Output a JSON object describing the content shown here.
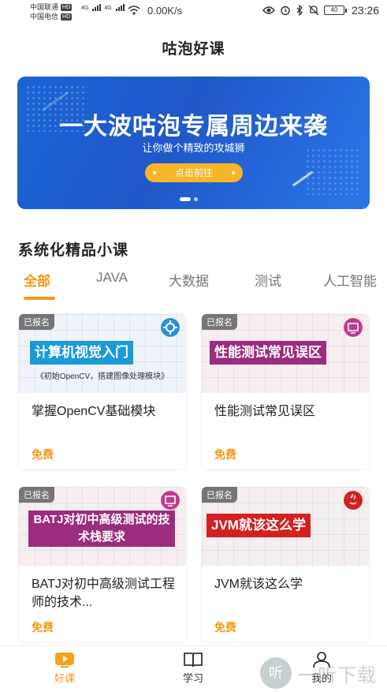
{
  "status_bar": {
    "carrier1": "中国联通",
    "carrier2": "中国电信",
    "hd": "HD",
    "net_type": "4G",
    "speed": "0.00K/s",
    "battery": "40",
    "time": "23:26"
  },
  "app": {
    "title": "咕泡好课"
  },
  "banner": {
    "headline": "一大波咕泡专属周边来袭",
    "subtitle": "让你做个精致的攻城狮",
    "button": "点击前往"
  },
  "section": {
    "title": "系统化精品小课"
  },
  "tabs": [
    "全部",
    "JAVA",
    "大数据",
    "测试",
    "人工智能"
  ],
  "courses": [
    {
      "badge": "已报名",
      "thumb_title": "计算机视觉入门",
      "thumb_sub": "《初始OpenCV，搭建图像处理模块》",
      "name": "掌握OpenCV基础模块",
      "price": "免费",
      "title_color": "#1a9bd7",
      "icon": "gear-icon"
    },
    {
      "badge": "已报名",
      "thumb_title": "性能测试常见误区",
      "thumb_sub": "",
      "name": "性能测试常见误区",
      "price": "免费",
      "title_color": "#9b2c7e",
      "icon": "chart-icon"
    },
    {
      "badge": "已报名",
      "thumb_title": "BATJ对初中高级测试的技术栈要求",
      "thumb_sub": "",
      "name": "BATJ对初中高级测试工程师的技术...",
      "price": "免费",
      "title_color": "#9b2c7e",
      "icon": "chart-icon"
    },
    {
      "badge": "已报名",
      "thumb_title": "JVM就该这么学",
      "thumb_sub": "",
      "name": "JVM就该这么学",
      "price": "免费",
      "title_color": "#d32020",
      "icon": "java-icon"
    }
  ],
  "bottom_nav": [
    {
      "label": "好课",
      "icon": "play-icon",
      "active": true
    },
    {
      "label": "学习",
      "icon": "book-icon",
      "active": false
    },
    {
      "label": "我的",
      "icon": "user-icon",
      "active": false
    }
  ],
  "watermark": {
    "mark": "听",
    "text": "一听下载"
  }
}
